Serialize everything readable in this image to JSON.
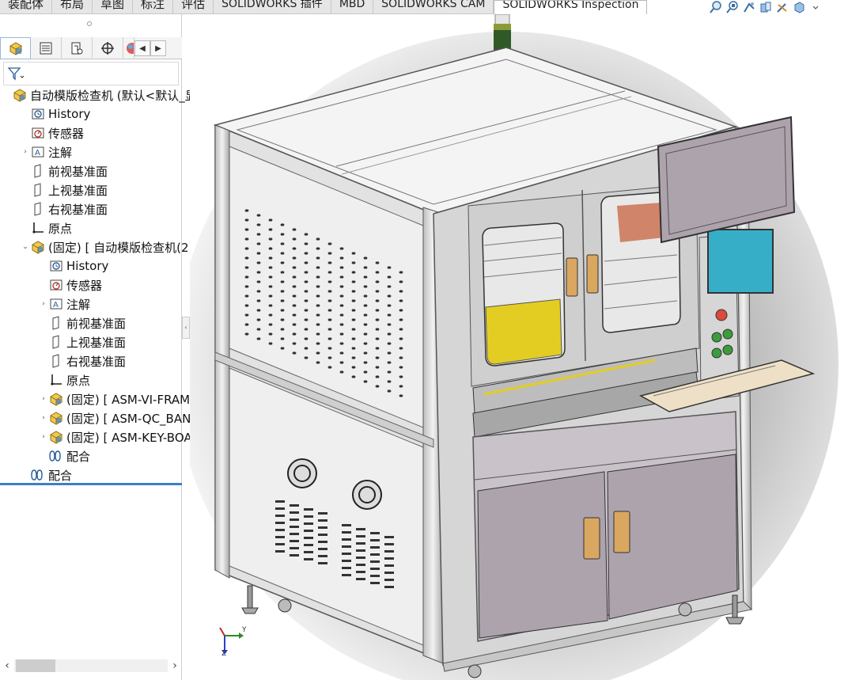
{
  "command_tabs": [
    {
      "label": "装配体",
      "active": false
    },
    {
      "label": "布局",
      "active": false
    },
    {
      "label": "草图",
      "active": false
    },
    {
      "label": "标注",
      "active": false
    },
    {
      "label": "评估",
      "active": false
    },
    {
      "label": "SOLIDWORKS 插件",
      "active": false
    },
    {
      "label": "MBD",
      "active": false
    },
    {
      "label": "SOLIDWORKS CAM",
      "active": false
    },
    {
      "label": "SOLIDWORKS Inspection",
      "active": true
    }
  ],
  "heads_up_toolbar": [
    "zoom-to-fit-icon",
    "zoom-to-area-icon",
    "previous-view-icon",
    "section-view-icon",
    "view-orientation-icon",
    "display-style-icon"
  ],
  "manager_tabs": [
    "feature-manager-icon",
    "property-manager-icon",
    "configuration-manager-icon",
    "dimxpert-icon",
    "display-manager-icon"
  ],
  "tree": [
    {
      "label": "自动模版检查机 (默认<默认_显",
      "icon": "assembly-icon",
      "indent": 0,
      "expander": ""
    },
    {
      "label": "History",
      "icon": "history-icon",
      "indent": 1,
      "expander": ""
    },
    {
      "label": "传感器",
      "icon": "sensor-icon",
      "indent": 1,
      "expander": ""
    },
    {
      "label": "注解",
      "icon": "annotation-icon",
      "indent": 1,
      "expander": "›"
    },
    {
      "label": "前视基准面",
      "icon": "plane-icon",
      "indent": 1,
      "expander": ""
    },
    {
      "label": "上视基准面",
      "icon": "plane-icon",
      "indent": 1,
      "expander": ""
    },
    {
      "label": "右视基准面",
      "icon": "plane-icon",
      "indent": 1,
      "expander": ""
    },
    {
      "label": "原点",
      "icon": "origin-icon",
      "indent": 1,
      "expander": ""
    },
    {
      "label": "(固定) [ 自动模版检查机(2)",
      "icon": "assembly-icon",
      "indent": 1,
      "expander": "⌄"
    },
    {
      "label": "History",
      "icon": "history-icon",
      "indent": 2,
      "expander": ""
    },
    {
      "label": "传感器",
      "icon": "sensor-icon",
      "indent": 2,
      "expander": ""
    },
    {
      "label": "注解",
      "icon": "annotation-icon",
      "indent": 2,
      "expander": "›"
    },
    {
      "label": "前视基准面",
      "icon": "plane-icon",
      "indent": 2,
      "expander": ""
    },
    {
      "label": "上视基准面",
      "icon": "plane-icon",
      "indent": 2,
      "expander": ""
    },
    {
      "label": "右视基准面",
      "icon": "plane-icon",
      "indent": 2,
      "expander": ""
    },
    {
      "label": "原点",
      "icon": "origin-icon",
      "indent": 2,
      "expander": ""
    },
    {
      "label": "(固定) [ ASM-VI-FRAM",
      "icon": "assembly-icon",
      "indent": 2,
      "expander": "›"
    },
    {
      "label": "(固定) [ ASM-QC_BAN",
      "icon": "assembly-icon",
      "indent": 2,
      "expander": "›"
    },
    {
      "label": "(固定) [ ASM-KEY-BOA",
      "icon": "assembly-icon",
      "indent": 2,
      "expander": "›"
    },
    {
      "label": "配合",
      "icon": "mates-icon",
      "indent": 2,
      "expander": ""
    },
    {
      "label": "配合",
      "icon": "mates-icon",
      "indent": 1,
      "expander": ""
    }
  ],
  "triad": {
    "y_label": "Y",
    "z_label": "Z"
  },
  "colors": {
    "accent": "#3b80c5",
    "frame": "#dcdcdc",
    "panel_fill": "#ececec",
    "door_fill": "#ada3ad",
    "screen": "#37aec8",
    "yellow": "#e3cd23",
    "handle": "#d9a760",
    "tray": "#eee0c6"
  }
}
